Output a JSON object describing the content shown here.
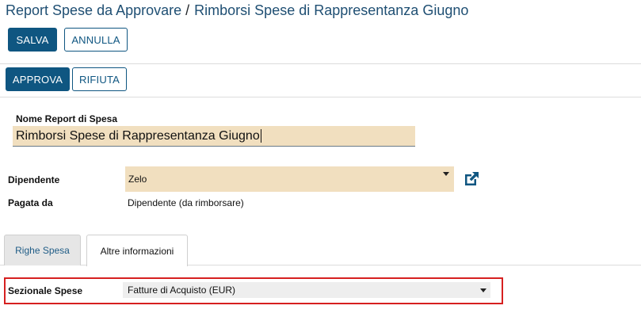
{
  "breadcrumb": {
    "parent": "Report Spese da Approvare",
    "separator": "/",
    "current": "Rimborsi Spese di Rappresentanza Giugno"
  },
  "toolbar": {
    "save_label": "SALVA",
    "cancel_label": "ANNULLA"
  },
  "statusbar": {
    "approve_label": "APPROVA",
    "reject_label": "RIFIUTA"
  },
  "form": {
    "name_label": "Nome Report di Spesa",
    "name_value": "Rimborsi Spese di Rappresentanza Giugno",
    "employee_label": "Dipendente",
    "employee_value": "Zelo",
    "paid_by_label": "Pagata da",
    "paid_by_value": "Dipendente (da rimborsare)"
  },
  "tabs": [
    {
      "label": "Righe Spesa",
      "active": false
    },
    {
      "label": "Altre informazioni",
      "active": true
    }
  ],
  "other_info": {
    "journal_label": "Sezionale Spese",
    "journal_value": "Fatture di Acquisto (EUR)"
  },
  "colors": {
    "primary": "#0f5681",
    "field_bg": "#f1dfbf",
    "highlight": "#d62020"
  },
  "icons": {
    "external_link": "external-link-icon",
    "dropdown": "chevron-down-icon"
  }
}
